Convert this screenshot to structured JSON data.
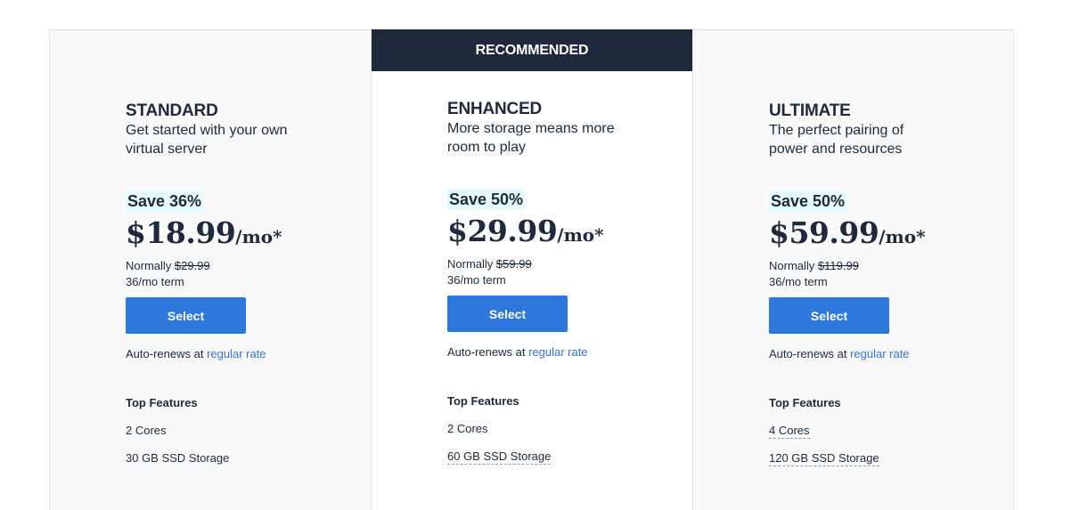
{
  "recommended_label": "RECOMMENDED",
  "plans": [
    {
      "name": "STANDARD",
      "description": "Get started with your own virtual server",
      "save": "Save 36%",
      "price": "$18.99",
      "price_unit": "/mo*",
      "normally_label": "Normally",
      "normal_price": "$29.99",
      "term": "36/mo term",
      "select_label": "Select",
      "renew_text": "Auto-renews at",
      "renew_link": "regular rate",
      "features_title": "Top Features",
      "features": [
        "2 Cores",
        "30 GB SSD Storage"
      ],
      "recommended": false
    },
    {
      "name": "ENHANCED",
      "description": "More storage means more room to play",
      "save": "Save 50%",
      "price": "$29.99",
      "price_unit": "/mo*",
      "normally_label": "Normally",
      "normal_price": "$59.99",
      "term": "36/mo term",
      "select_label": "Select",
      "renew_text": "Auto-renews at",
      "renew_link": "regular rate",
      "features_title": "Top Features",
      "features": [
        "2 Cores",
        "60 GB SSD Storage"
      ],
      "recommended": true
    },
    {
      "name": "ULTIMATE",
      "description": "The perfect pairing of power and resources",
      "save": "Save 50%",
      "price": "$59.99",
      "price_unit": "/mo*",
      "normally_label": "Normally",
      "normal_price": "$119.99",
      "term": "36/mo term",
      "select_label": "Select",
      "renew_text": "Auto-renews at",
      "renew_link": "regular rate",
      "features_title": "Top Features",
      "features": [
        "4 Cores",
        "120 GB SSD Storage"
      ],
      "recommended": false
    }
  ],
  "colors": {
    "banner": "#1e2a3b",
    "select_button": "#2e78dc",
    "save_highlight": "#e6fbfd",
    "link": "#3a73d1"
  }
}
